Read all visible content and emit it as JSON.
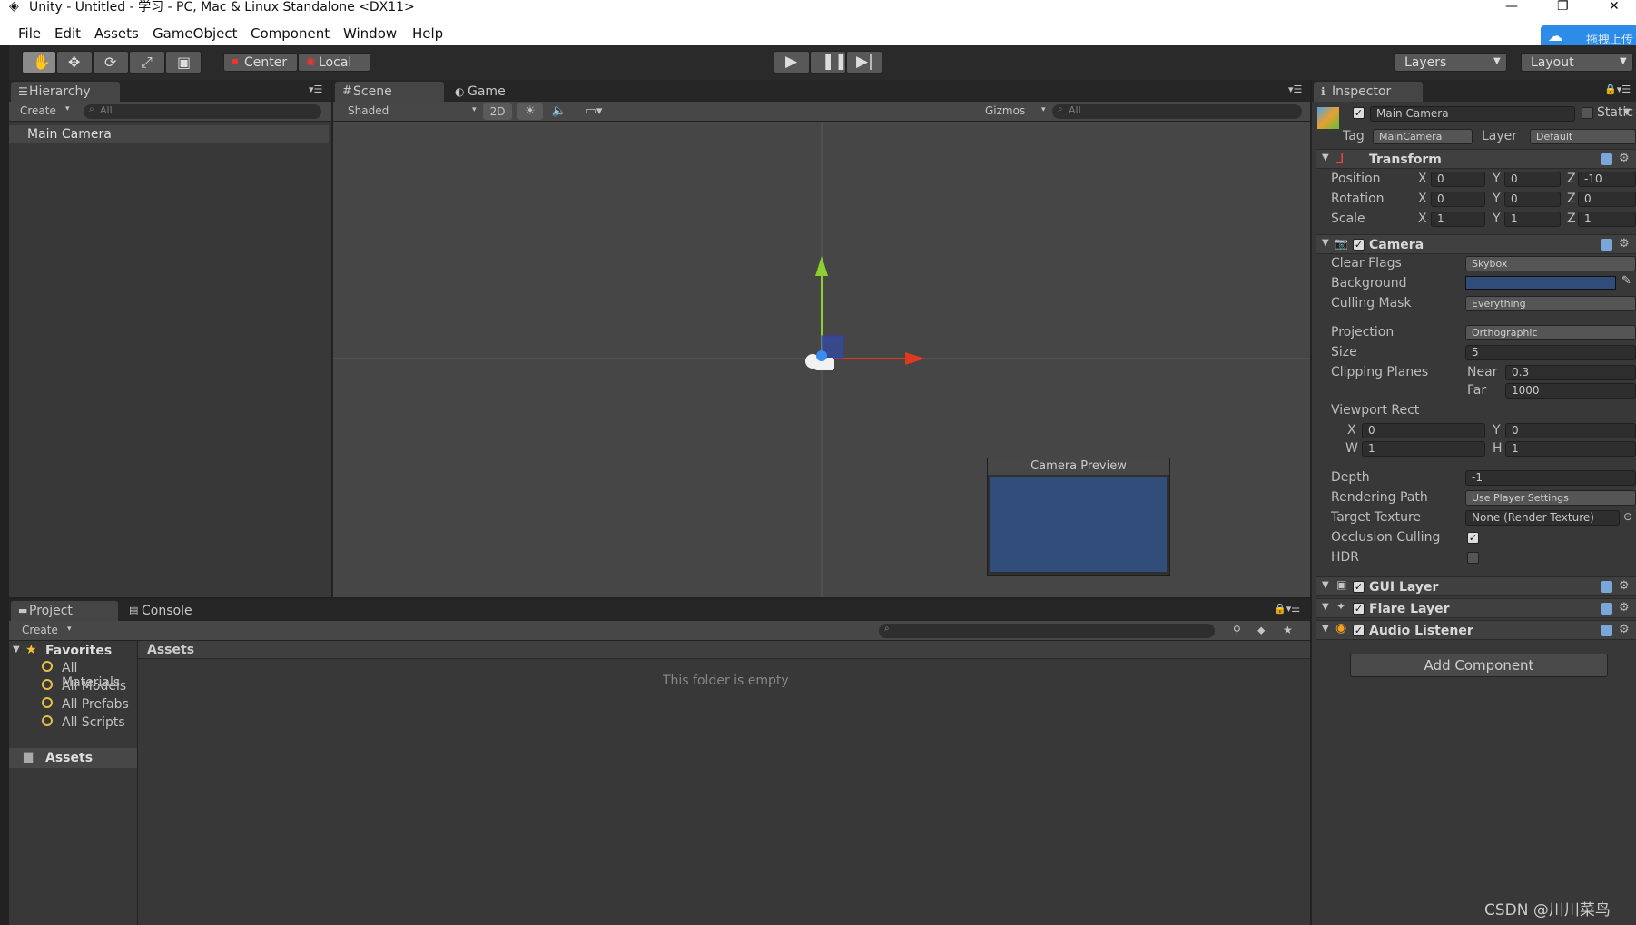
{
  "window": {
    "title": "Unity - Untitled - 学习 - PC, Mac & Linux Standalone <DX11>",
    "cloud_label": "拖拽上传"
  },
  "menu": [
    "File",
    "Edit",
    "Assets",
    "GameObject",
    "Component",
    "Window",
    "Help"
  ],
  "toolbar": {
    "center_label": "Center",
    "local_label": "Local",
    "layers_label": "Layers",
    "layout_label": "Layout"
  },
  "hierarchy": {
    "tab": "Hierarchy",
    "create": "Create",
    "search_placeholder": "All",
    "items": [
      "Main Camera"
    ]
  },
  "scene": {
    "tab_scene": "Scene",
    "tab_game": "Game",
    "shading": "Shaded",
    "mode_2d": "2D",
    "gizmos": "Gizmos",
    "search_placeholder": "All",
    "preview_title": "Camera Preview"
  },
  "project": {
    "tab_project": "Project",
    "tab_console": "Console",
    "create": "Create",
    "favorites": "Favorites",
    "favorites_items": [
      "All Materials",
      "All Models",
      "All Prefabs",
      "All Scripts"
    ],
    "assets_root": "Assets",
    "assets_header": "Assets",
    "empty_msg": "This folder is empty"
  },
  "inspector": {
    "tab": "Inspector",
    "object_name": "Main Camera",
    "static_label": "Static",
    "tag_label": "Tag",
    "tag_value": "MainCamera",
    "layer_label": "Layer",
    "layer_value": "Default",
    "transform": {
      "title": "Transform",
      "rows": [
        {
          "label": "Position",
          "x": "0",
          "y": "0",
          "z": "-10"
        },
        {
          "label": "Rotation",
          "x": "0",
          "y": "0",
          "z": "0"
        },
        {
          "label": "Scale",
          "x": "1",
          "y": "1",
          "z": "1"
        }
      ]
    },
    "camera": {
      "title": "Camera",
      "clear_flags_label": "Clear Flags",
      "clear_flags": "Skybox",
      "background_label": "Background",
      "culling_mask_label": "Culling Mask",
      "culling_mask": "Everything",
      "projection_label": "Projection",
      "projection": "Orthographic",
      "size_label": "Size",
      "size": "5",
      "clipping_label": "Clipping Planes",
      "near_label": "Near",
      "near": "0.3",
      "far_label": "Far",
      "far": "1000",
      "viewport_label": "Viewport Rect",
      "vx": "0",
      "vy": "0",
      "vw": "1",
      "vh": "1",
      "depth_label": "Depth",
      "depth": "-1",
      "rendering_path_label": "Rendering Path",
      "rendering_path": "Use Player Settings",
      "target_texture_label": "Target Texture",
      "target_texture": "None (Render Texture)",
      "occlusion_label": "Occlusion Culling",
      "hdr_label": "HDR"
    },
    "components": [
      "GUI Layer",
      "Flare Layer",
      "Audio Listener"
    ],
    "add_component": "Add Component"
  },
  "watermark": "CSDN @川川菜鸟",
  "colors": {
    "camera_bg": "#314d79",
    "gizmo_y": "#8ecf2f",
    "gizmo_x": "#e0391f"
  }
}
